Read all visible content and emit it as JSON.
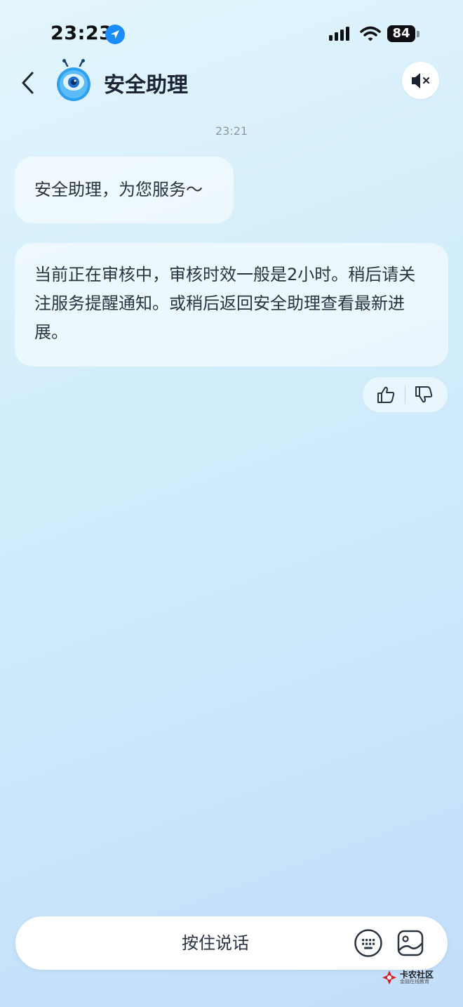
{
  "status_bar": {
    "time": "23:23",
    "battery": "84"
  },
  "header": {
    "title": "安全助理"
  },
  "chat": {
    "timestamp": "23:21",
    "messages": [
      {
        "text": "安全助理，为您服务～"
      },
      {
        "text": "当前正在审核中，审核时效一般是2小时。稍后请关注服务提醒通知。或稍后返回安全助理查看最新进展。"
      }
    ]
  },
  "input_bar": {
    "hold_to_talk_label": "按住说话"
  },
  "watermark": {
    "name": "卡农社区",
    "subtitle": "金融在线教育"
  },
  "colors": {
    "accent": "#1a8cff",
    "text": "#2a3340",
    "bubble": "#ffffff"
  },
  "icons": [
    "location-arrow-icon",
    "signal-icon",
    "wifi-icon",
    "battery-icon",
    "back-chevron-icon",
    "assistant-avatar-icon",
    "mute-speaker-icon",
    "thumbs-up-icon",
    "thumbs-down-icon",
    "keyboard-icon",
    "image-icon"
  ]
}
